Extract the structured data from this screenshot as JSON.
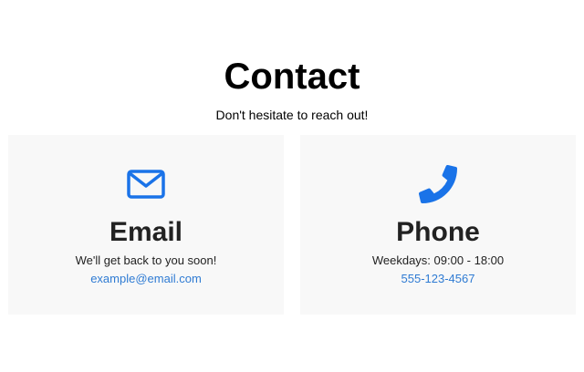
{
  "header": {
    "title": "Contact",
    "subtitle": "Don't hesitate to reach out!"
  },
  "cards": [
    {
      "icon": "envelope-icon",
      "title": "Email",
      "description": "We'll get back to you soon!",
      "link": "example@email.com"
    },
    {
      "icon": "phone-icon",
      "title": "Phone",
      "description": "Weekdays: 09:00 - 18:00",
      "link": "555-123-4567"
    }
  ],
  "colors": {
    "accent": "#1a73e8",
    "link": "#2f7bd3",
    "card_background": "#f8f8f8"
  }
}
